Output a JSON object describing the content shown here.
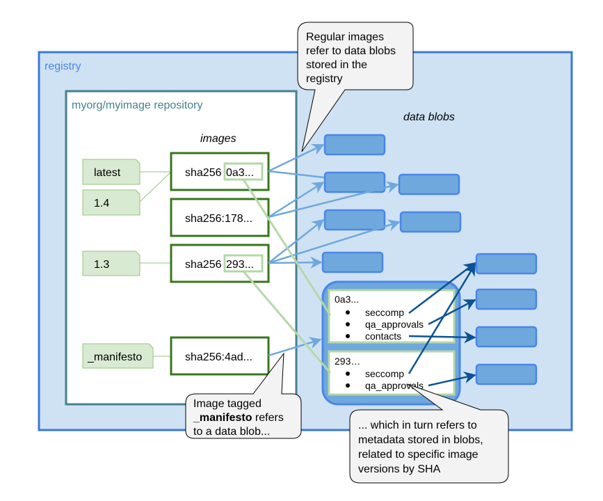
{
  "registry": {
    "label": "registry"
  },
  "repository": {
    "label": "myorg/myimage repository"
  },
  "images_heading": "images",
  "data_blobs_heading": "data blobs",
  "tags": [
    {
      "label": "latest"
    },
    {
      "label": "1.4"
    },
    {
      "label": "1.3"
    },
    {
      "label": "_manifesto"
    }
  ],
  "images": [
    {
      "prefix": "sha256",
      "hash": "0a3...",
      "highlighted": true
    },
    {
      "prefix": "sha256:178...",
      "hash": "",
      "highlighted": false
    },
    {
      "prefix": "sha256",
      "hash": "293...",
      "highlighted": true
    },
    {
      "prefix": "sha256:4ad...",
      "hash": "",
      "highlighted": false
    }
  ],
  "manifest": {
    "entries": [
      {
        "title": "0a3...",
        "items": [
          "seccomp",
          "qa_approvals",
          "contacts"
        ]
      },
      {
        "title": "293…",
        "items": [
          "seccomp",
          "qa_approvals"
        ]
      }
    ]
  },
  "callouts": {
    "regular": [
      "Regular images",
      "refer to data blobs",
      "stored in the",
      "registry"
    ],
    "manifesto": {
      "line1": "Image tagged",
      "bold": "_manifesto",
      "line2_rest": " refers",
      "line3": "to a data blob..."
    },
    "metadata": [
      "... which in turn refers to",
      "metadata stored in blobs,",
      "related to specific image",
      "versions by SHA"
    ]
  },
  "colors": {
    "registry_fill": "#cfe2f3",
    "registry_border": "#3c78d8",
    "repo_border": "#45818e",
    "tag_fill": "#d9ead3",
    "tag_border": "#93c47d",
    "image_border": "#38761d",
    "highlight_border": "#b6d7a8",
    "blob_fill": "#6fa8dc",
    "blob_border": "#4a86e8",
    "arrow_light": "#6fa8dc",
    "arrow_dark": "#0b5394",
    "callout_fill": "#f3f3f3"
  }
}
